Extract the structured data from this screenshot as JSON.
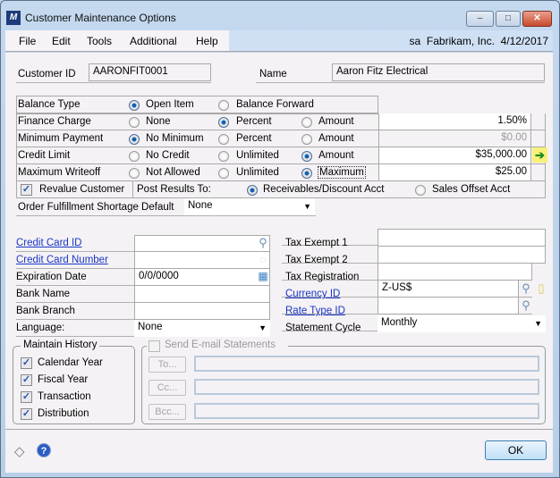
{
  "window": {
    "title": "Customer Maintenance Options",
    "logo_text": "/\\\\",
    "minimize_icon": "–",
    "maximize_icon": "□",
    "close_icon": "✕"
  },
  "menu": {
    "items": [
      "File",
      "Edit",
      "Tools",
      "Additional",
      "Help"
    ],
    "user": "sa",
    "company": "Fabrikam, Inc.",
    "date": "4/12/2017"
  },
  "header": {
    "customer_id_label": "Customer ID",
    "customer_id_value": "AARONFIT0001",
    "name_label": "Name",
    "name_value": "Aaron Fitz Electrical"
  },
  "options": {
    "balance_type": {
      "label": "Balance Type",
      "options": [
        "Open Item",
        "Balance Forward"
      ],
      "selected": "Open Item"
    },
    "finance_charge": {
      "label": "Finance Charge",
      "options": [
        "None",
        "Percent",
        "Amount"
      ],
      "selected": "Percent",
      "value": "1.50%"
    },
    "minimum_payment": {
      "label": "Minimum Payment",
      "options": [
        "No Minimum",
        "Percent",
        "Amount"
      ],
      "selected": "No Minimum",
      "value": "$0.00"
    },
    "credit_limit": {
      "label": "Credit Limit",
      "options": [
        "No Credit",
        "Unlimited",
        "Amount"
      ],
      "selected": "Amount",
      "value": "$35,000.00",
      "expand_icon": "➔"
    },
    "maximum_writeoff": {
      "label": "Maximum Writeoff",
      "options": [
        "Not Allowed",
        "Unlimited",
        "Maximum"
      ],
      "selected": "Maximum",
      "value": "$25.00"
    },
    "revalue_customer": {
      "label": "Revalue Customer",
      "checked": true
    },
    "post_results": {
      "label": "Post Results To:",
      "options": [
        "Receivables/Discount Acct",
        "Sales Offset Acct"
      ],
      "selected": "Receivables/Discount Acct"
    },
    "order_fulfillment": {
      "label": "Order Fulfillment Shortage Default",
      "value": "None"
    }
  },
  "left_fields": [
    {
      "label": "Credit Card ID",
      "value": "",
      "link": true
    },
    {
      "label": "Credit Card Number",
      "value": "",
      "link": true
    },
    {
      "label": "Expiration Date",
      "value": "0/0/0000",
      "link": false
    },
    {
      "label": "Bank Name",
      "value": "",
      "link": false
    },
    {
      "label": "Bank Branch",
      "value": "",
      "link": false
    },
    {
      "label": "Language:",
      "value": "None",
      "link": false
    }
  ],
  "right_fields": [
    {
      "label": "Tax Exempt 1",
      "value": "",
      "link": false
    },
    {
      "label": "Tax Exempt 2",
      "value": "",
      "link": false
    },
    {
      "label": "Tax Registration",
      "value": "",
      "link": false
    },
    {
      "label": "Currency ID",
      "value": "Z-US$",
      "link": true
    },
    {
      "label": "Rate Type ID",
      "value": "",
      "link": true
    },
    {
      "label": "Statement Cycle",
      "value": "Monthly",
      "link": false
    }
  ],
  "maintain_history": {
    "title": "Maintain History",
    "items": [
      {
        "label": "Calendar Year",
        "checked": true
      },
      {
        "label": "Fiscal Year",
        "checked": true
      },
      {
        "label": "Transaction",
        "checked": true
      },
      {
        "label": "Distribution",
        "checked": true
      }
    ]
  },
  "email_statements": {
    "title": "Send E-mail Statements",
    "checked": false,
    "buttons": [
      "To...",
      "Cc...",
      "Bcc..."
    ]
  },
  "footer": {
    "ok_label": "OK",
    "note_icon": "◇",
    "help_icon": "?"
  },
  "glyphs": {
    "check": "✓",
    "dropdown": "▼",
    "lookup": "⚲",
    "calendar": "▦",
    "note": "▯"
  }
}
